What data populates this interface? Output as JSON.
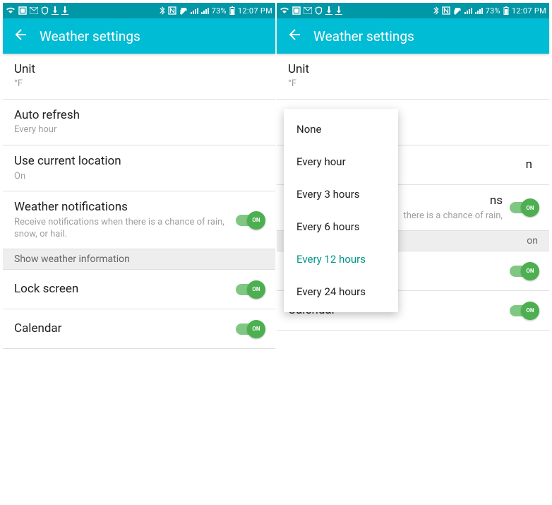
{
  "status": {
    "battery": "73%",
    "time": "12:07 PM"
  },
  "appbar": {
    "title": "Weather settings"
  },
  "settings": {
    "unit": {
      "title": "Unit",
      "sub": "°F"
    },
    "autoRefresh": {
      "title": "Auto refresh",
      "sub": "Every hour"
    },
    "useLocation": {
      "title": "Use current location",
      "sub": "On"
    },
    "notifications": {
      "title": "Weather notifications",
      "sub": "Receive notifications when there is a chance of rain, snow, or hail."
    },
    "sectionHeader": "Show weather information",
    "lockscreen": {
      "title": "Lock screen"
    },
    "calendar": {
      "title": "Calendar"
    },
    "toggleLabel": "ON"
  },
  "right": {
    "notificationsSubVisible": "there is a chance of rain,",
    "sectionHeaderVisible": "on"
  },
  "menu": {
    "items": [
      "None",
      "Every hour",
      "Every 3 hours",
      "Every 6 hours",
      "Every 12 hours",
      "Every 24 hours"
    ],
    "selectedIndex": 4
  }
}
